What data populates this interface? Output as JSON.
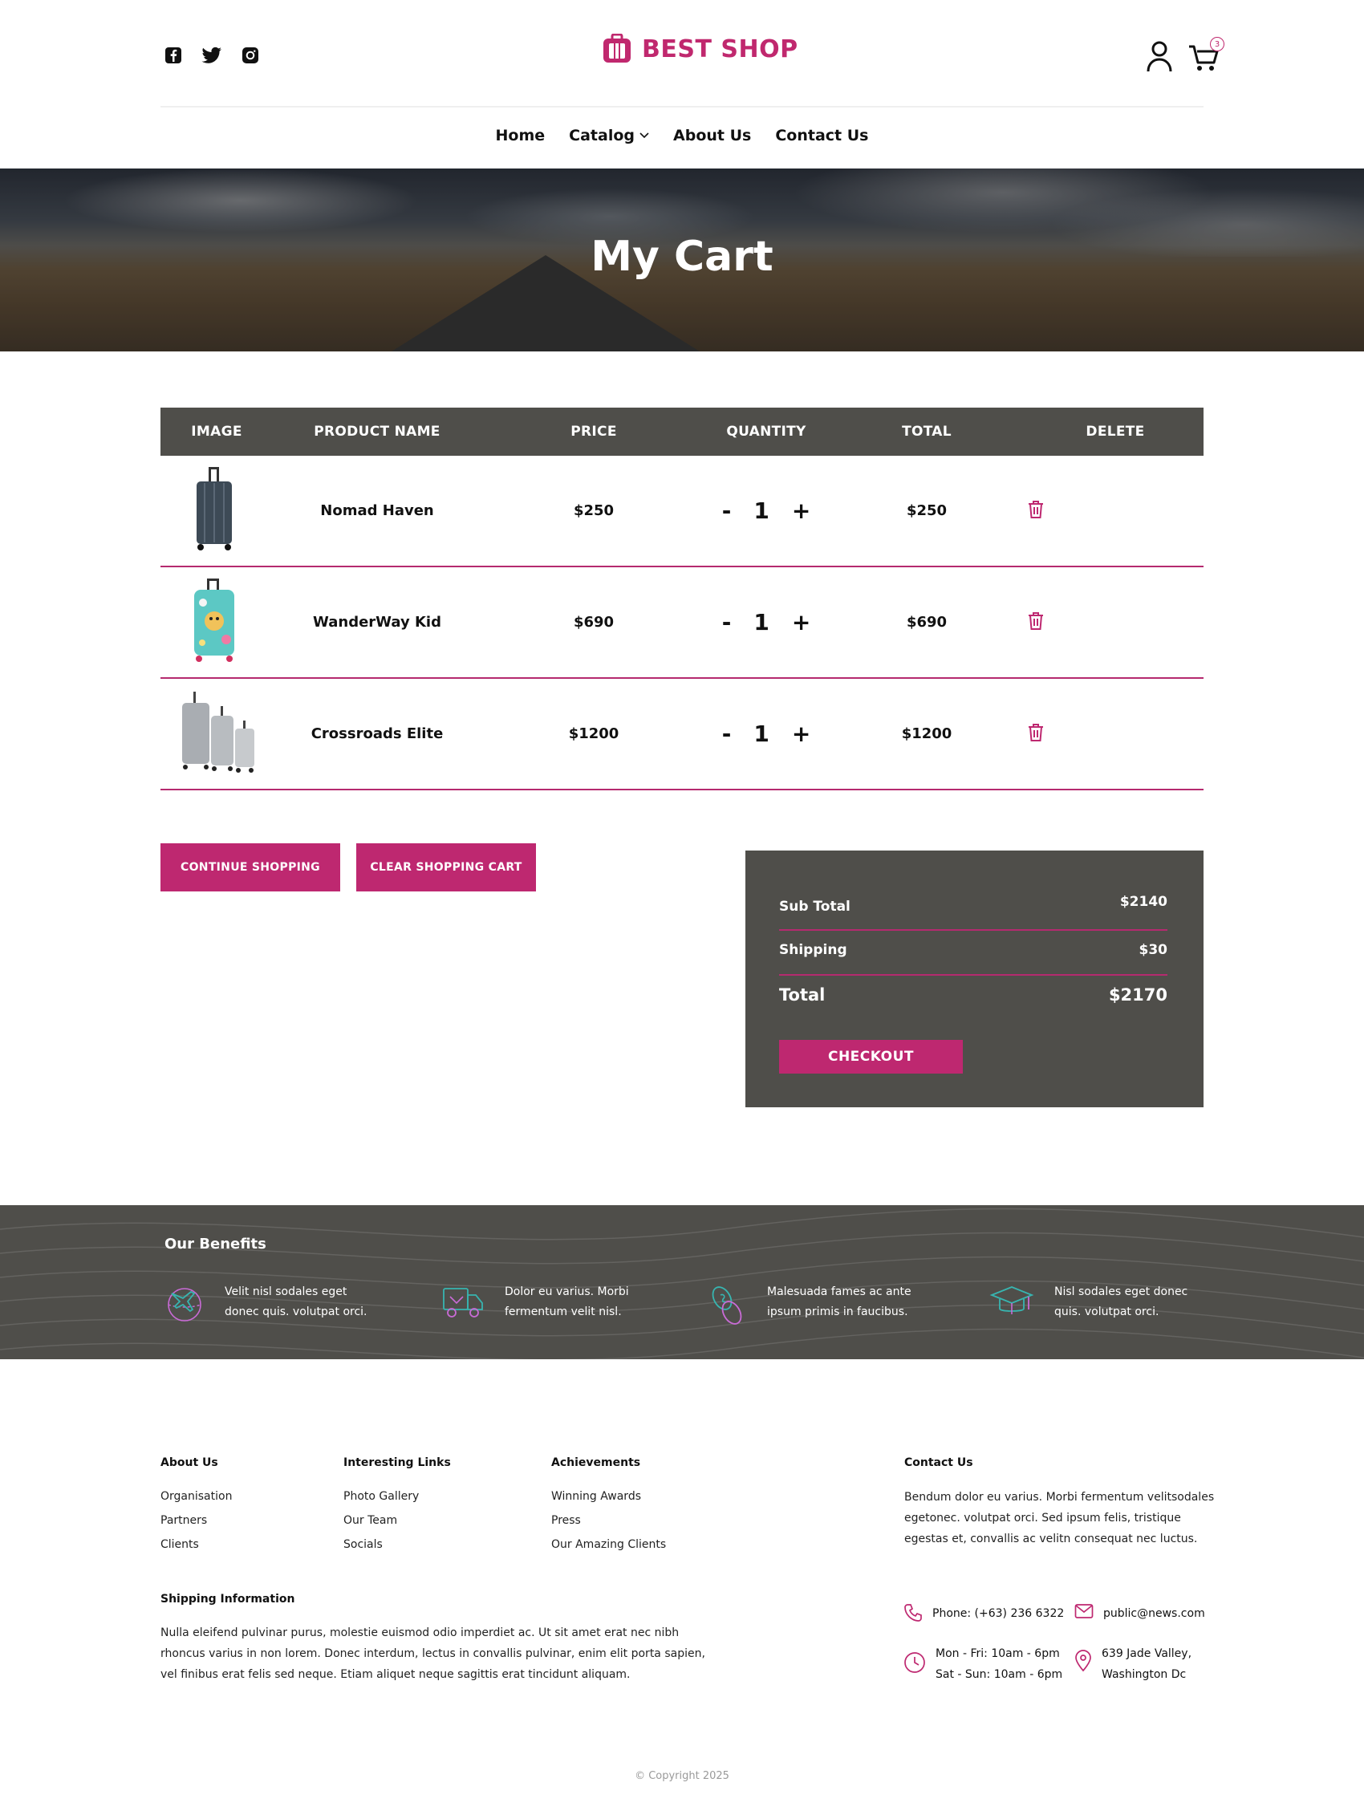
{
  "header": {
    "brand": "BEST SHOP",
    "cart_count": "3",
    "social": [
      "facebook-icon",
      "twitter-icon",
      "instagram-icon"
    ]
  },
  "nav": {
    "items": [
      "Home",
      "Catalog",
      "About Us",
      "Contact Us"
    ]
  },
  "hero": {
    "title": "My Cart"
  },
  "cart": {
    "columns": [
      "IMAGE",
      "PRODUCT NAME",
      "PRICE",
      "QUANTITY",
      "TOTAL",
      "DELETE"
    ],
    "rows": [
      {
        "name": "Nomad Haven",
        "price": "$250",
        "qty": "1",
        "total": "$250"
      },
      {
        "name": "WanderWay Kid",
        "price": "$690",
        "qty": "1",
        "total": "$690"
      },
      {
        "name": "Crossroads Elite",
        "price": "$1200",
        "qty": "1",
        "total": "$1200"
      }
    ],
    "minus": "-",
    "plus": "+"
  },
  "actions": {
    "continue": "CONTINUE SHOPPING",
    "clear": "CLEAR SHOPPING CART"
  },
  "summary": {
    "subtotal_label": "Sub Total",
    "subtotal": "$2140",
    "shipping_label": "Shipping",
    "shipping": "$30",
    "total_label": "Total",
    "total": "$2170",
    "checkout": "CHECKOUT"
  },
  "benefits": {
    "title": "Our Benefits",
    "items": [
      {
        "line1": "Velit nisl sodales eget",
        "line2": "donec quis. volutpat orci.",
        "icon": "airplane-globe-icon"
      },
      {
        "line1": "Dolor eu varius. Morbi",
        "line2": "fermentum velit nisl.",
        "icon": "delivery-truck-icon"
      },
      {
        "line1": "Malesuada fames ac ante",
        "line2": "ipsum primis in faucibus.",
        "icon": "coins-icon"
      },
      {
        "line1": "Nisl sodales eget donec",
        "line2": "quis. volutpat orci.",
        "icon": "graduation-cap-icon"
      }
    ]
  },
  "footer": {
    "about": {
      "title": "About Us",
      "links": [
        "Organisation",
        "Partners",
        "Clients"
      ]
    },
    "links": {
      "title": "Interesting Links",
      "links": [
        "Photo Gallery",
        "Our Team",
        "Socials"
      ]
    },
    "achievements": {
      "title": "Achievements",
      "links": [
        "Winning Awards",
        "Press",
        "Our Amazing Clients"
      ]
    },
    "contact": {
      "title": "Contact Us",
      "text_lines": [
        "Bendum dolor eu varius. Morbi fermentum velitsodales",
        "egetonec. volutpat orci. Sed ipsum felis, tristique",
        "egestas et, convallis ac velitn consequat nec luctus."
      ],
      "phone": "Phone: (+63) 236 6322",
      "email": "public@news.com",
      "hours_1": "Mon - Fri: 10am - 6pm",
      "hours_2": "Sat - Sun: 10am - 6pm",
      "address_1": "639 Jade Valley,",
      "address_2": "Washington Dc"
    },
    "shipping": {
      "title": "Shipping Information",
      "text_lines": [
        "Nulla eleifend pulvinar purus, molestie euismod odio imperdiet ac. Ut sit amet erat nec nibh",
        "rhoncus varius in non lorem. Donec interdum, lectus in convallis pulvinar, enim elit porta sapien,",
        "vel finibus erat felis sed neque. Etiam aliquet neque sagittis erat tincidunt aliquam."
      ]
    },
    "copyright": "© Copyright 2025"
  },
  "colors": {
    "accent": "#be2870",
    "dark": "#4f4e4a",
    "teal": "#37b5b0"
  }
}
